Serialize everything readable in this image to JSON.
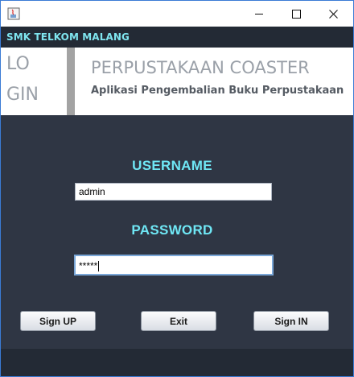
{
  "window": {
    "icon": "java-app-icon",
    "controls": {
      "minimize": "minimize-icon",
      "maximize": "maximize-icon",
      "close": "close-icon"
    }
  },
  "header": {
    "school": "SMK TELKOM MALANG"
  },
  "banner": {
    "login_line1": "LO",
    "login_line2": "GIN",
    "title": "PERPUSTAKAAN COASTER",
    "subtitle": "Aplikasi Pengembalian Buku Perpustakaan"
  },
  "form": {
    "username_label": "USERNAME",
    "username_value": "admin",
    "password_label": "PASSWORD",
    "password_value": "*****"
  },
  "buttons": {
    "sign_up": "Sign UP",
    "exit": "Exit",
    "sign_in": "Sign IN"
  },
  "colors": {
    "background": "#2f3644",
    "header": "#232a35",
    "label": "#6fe7f5",
    "school": "#7fe5ef"
  }
}
